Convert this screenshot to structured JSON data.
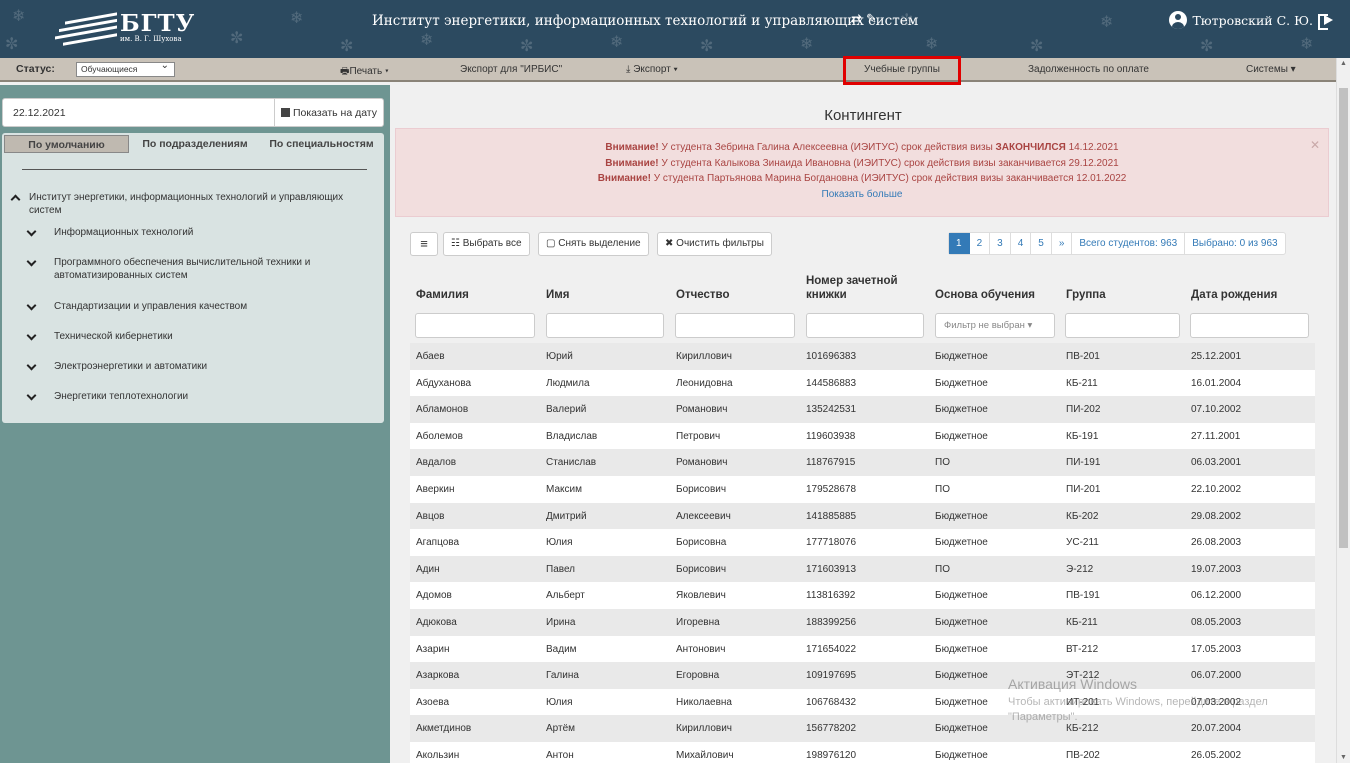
{
  "header": {
    "logo_title": "БГТУ",
    "logo_sub": "им. В. Г. Шухова",
    "institute": "Институт энергетики, информационных технологий и управляющих систем",
    "user": "Тютровский С. Ю."
  },
  "menubar": {
    "status_label": "Статус:",
    "status_value": "Обучающиеся",
    "print": "Печать ▾",
    "export_irbis": "Экспорт для \"ИРБИС\"",
    "export": "Экспорт ▾",
    "groups": "Учебные группы",
    "debt": "Задолженность по оплате",
    "systems": "Системы ▾"
  },
  "left": {
    "date": "22.12.2021",
    "show_date": "Показать на дату",
    "tabs": [
      "По умолчанию",
      "По подразделениям",
      "По специальностям"
    ],
    "tree_root": "Институт энергетики, информационных технологий и управляющих систем",
    "tree_items": [
      "Информационных технологий",
      "Программного обеспечения вычислительной техники и автоматизированных систем",
      "Стандартизации и управления качеством",
      "Технической кибернетики",
      "Электроэнергетики и автоматики",
      "Энергетики теплотехнологии"
    ]
  },
  "main": {
    "title": "Контингент",
    "alerts": [
      {
        "prefix": "Внимание!",
        "text": "У студента Зебрина Галина Алексеевна (ИЭИТУС) срок действия визы",
        "strong": "ЗАКОНЧИЛСЯ",
        "date": "14.12.2021"
      },
      {
        "prefix": "Внимание!",
        "text": "У студента Калыкова Зинаида Ивановна (ИЭИТУС) срок действия визы заканчивается 29.12.2021"
      },
      {
        "prefix": "Внимание!",
        "text": "У студента Партьянова Марина Богдановна (ИЭИТУС) срок действия визы заканчивается 12.01.2022"
      }
    ],
    "show_more": "Показать больше",
    "buttons": {
      "menu": "≡",
      "select_all": "Выбрать все",
      "deselect": "Снять выделение",
      "clear_filters": "Очистить фильтры"
    },
    "pager": {
      "pages": [
        "1",
        "2",
        "3",
        "4",
        "5",
        "»"
      ],
      "total": "Всего студентов: 963",
      "selected": "Выбрано: 0 из 963"
    },
    "columns": [
      "Фамилия",
      "Имя",
      "Отчество",
      "Номер зачетной книжки",
      "Основа обучения",
      "Группа",
      "Дата рождения"
    ],
    "filter_placeholder": "Фильтр не выбран",
    "rows": [
      [
        "Абаев",
        "Юрий",
        "Кириллович",
        "101696383",
        "Бюджетное",
        "ПВ-201",
        "25.12.2001"
      ],
      [
        "Абдуханова",
        "Людмила",
        "Леонидовна",
        "144586883",
        "Бюджетное",
        "КБ-211",
        "16.01.2004"
      ],
      [
        "Абламонов",
        "Валерий",
        "Романович",
        "135242531",
        "Бюджетное",
        "ПИ-202",
        "07.10.2002"
      ],
      [
        "Аболемов",
        "Владислав",
        "Петрович",
        "119603938",
        "Бюджетное",
        "КБ-191",
        "27.11.2001"
      ],
      [
        "Авдалов",
        "Станислав",
        "Романович",
        "118767915",
        "ПО",
        "ПИ-191",
        "06.03.2001"
      ],
      [
        "Аверкин",
        "Максим",
        "Борисович",
        "179528678",
        "ПО",
        "ПИ-201",
        "22.10.2002"
      ],
      [
        "Авцов",
        "Дмитрий",
        "Алексеевич",
        "141885885",
        "Бюджетное",
        "КБ-202",
        "29.08.2002"
      ],
      [
        "Агапцова",
        "Юлия",
        "Борисовна",
        "177718076",
        "Бюджетное",
        "УС-211",
        "26.08.2003"
      ],
      [
        "Адин",
        "Павел",
        "Борисович",
        "171603913",
        "ПО",
        "Э-212",
        "19.07.2003"
      ],
      [
        "Адомов",
        "Альберт",
        "Яковлевич",
        "113816392",
        "Бюджетное",
        "ПВ-191",
        "06.12.2000"
      ],
      [
        "Адюкова",
        "Ирина",
        "Игоревна",
        "188399256",
        "Бюджетное",
        "КБ-211",
        "08.05.2003"
      ],
      [
        "Азарин",
        "Вадим",
        "Антонович",
        "171654022",
        "Бюджетное",
        "ВТ-212",
        "17.05.2003"
      ],
      [
        "Азаркова",
        "Галина",
        "Егоровна",
        "109197695",
        "Бюджетное",
        "ЭТ-212",
        "06.07.2000"
      ],
      [
        "Азоева",
        "Юлия",
        "Николаевна",
        "106768432",
        "Бюджетное",
        "ИТ-201",
        "07.03.2002"
      ],
      [
        "Акметдинов",
        "Артём",
        "Кириллович",
        "156778202",
        "Бюджетное",
        "КБ-212",
        "20.07.2004"
      ],
      [
        "Акользин",
        "Антон",
        "Михайлович",
        "198976120",
        "Бюджетное",
        "ПВ-202",
        "26.05.2002"
      ]
    ]
  },
  "watermark": {
    "title": "Активация Windows",
    "text": "Чтобы активировать Windows, перейдите в раздел \"Параметры\"."
  }
}
